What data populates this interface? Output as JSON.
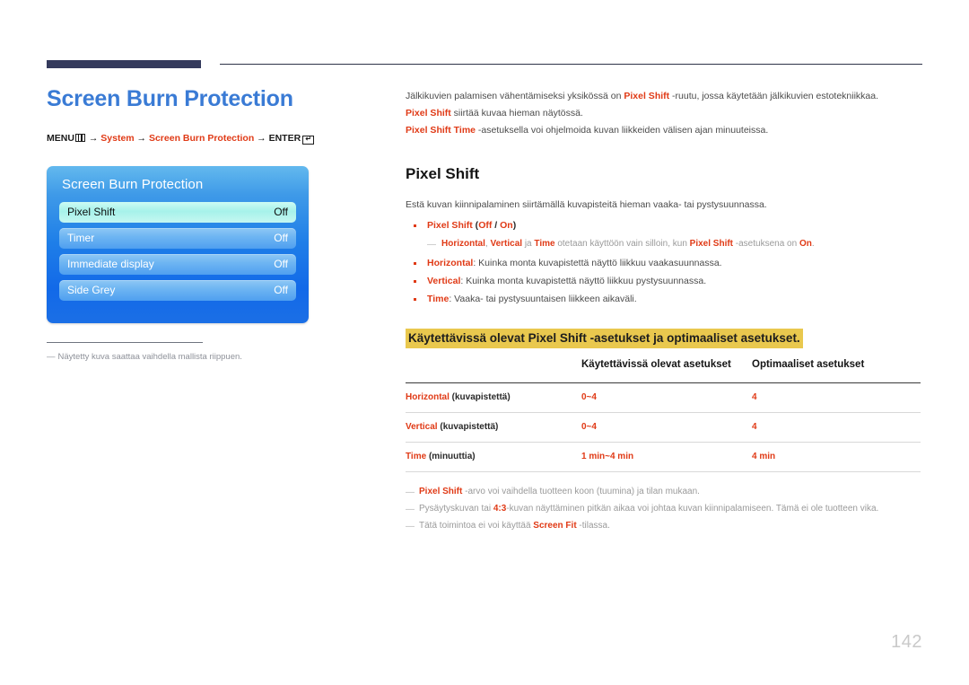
{
  "page": {
    "number": "142"
  },
  "left": {
    "title": "Screen Burn Protection",
    "menu_path": {
      "menu_label": "MENU",
      "menu_icon": "menu-grid-icon",
      "arrow": "→",
      "step1": "System",
      "step2": "Screen Burn Protection",
      "enter_label": "ENTER",
      "enter_icon": "enter-key-icon",
      "enter_glyph": "↵"
    },
    "osd": {
      "title": "Screen Burn Protection",
      "rows": [
        {
          "label": "Pixel Shift",
          "value": "Off",
          "selected": true
        },
        {
          "label": "Timer",
          "value": "Off",
          "selected": false
        },
        {
          "label": "Immediate display",
          "value": "Off",
          "selected": false
        },
        {
          "label": "Side Grey",
          "value": "Off",
          "selected": false
        }
      ]
    },
    "caption": {
      "dash": "―",
      "text": "Näytetty kuva saattaa vaihdella mallista riippuen."
    }
  },
  "right": {
    "intro": [
      {
        "parts": [
          {
            "t": "Jälkikuvien palamisen vähentämiseksi yksikössä on ",
            "s": "plain"
          },
          {
            "t": "Pixel Shift",
            "s": "red"
          },
          {
            "t": " -ruutu, jossa käytetään jälkikuvien estotekniikkaa.",
            "s": "plain"
          }
        ]
      },
      {
        "parts": [
          {
            "t": "Pixel Shift",
            "s": "red"
          },
          {
            "t": " siirtää kuvaa hieman näytössä.",
            "s": "plain"
          }
        ]
      },
      {
        "parts": [
          {
            "t": "Pixel Shift Time",
            "s": "red"
          },
          {
            "t": " -asetuksella voi ohjelmoida kuvan liikkeiden välisen ajan minuuteissa.",
            "s": "plain"
          }
        ]
      }
    ],
    "section_title": "Pixel Shift",
    "lead": "Estä kuvan kiinnipalaminen siirtämällä kuvapisteitä hieman vaaka- tai pystysuunnassa.",
    "bullets": [
      {
        "parts": [
          {
            "t": "Pixel Shift",
            "s": "red"
          },
          {
            "t": " (",
            "s": "dark"
          },
          {
            "t": "Off",
            "s": "red"
          },
          {
            "t": " / ",
            "s": "dark"
          },
          {
            "t": "On",
            "s": "red"
          },
          {
            "t": ")",
            "s": "dark"
          }
        ]
      },
      {
        "parts": [
          {
            "t": "Horizontal",
            "s": "red"
          },
          {
            "t": ": Kuinka monta kuvapistettä näyttö liikkuu vaakasuunnassa.",
            "s": "plain"
          }
        ]
      },
      {
        "parts": [
          {
            "t": "Vertical",
            "s": "red"
          },
          {
            "t": ": Kuinka monta kuvapistettä näyttö liikkuu pystysuunnassa.",
            "s": "plain"
          }
        ]
      },
      {
        "parts": [
          {
            "t": "Time",
            "s": "red"
          },
          {
            "t": ": Vaaka- tai pystysuuntaisen liikkeen aikaväli.",
            "s": "plain"
          }
        ]
      }
    ],
    "subnote": {
      "dash": "―",
      "parts": [
        {
          "t": "Horizontal",
          "s": "red"
        },
        {
          "t": ", ",
          "s": "plain"
        },
        {
          "t": "Vertical",
          "s": "red"
        },
        {
          "t": " ja ",
          "s": "plain"
        },
        {
          "t": "Time",
          "s": "red"
        },
        {
          "t": " otetaan käyttöön vain silloin, kun ",
          "s": "plain"
        },
        {
          "t": "Pixel Shift",
          "s": "red"
        },
        {
          "t": " -asetuksena on ",
          "s": "plain"
        },
        {
          "t": "On",
          "s": "red"
        },
        {
          "t": ".",
          "s": "plain"
        }
      ]
    },
    "highlight_heading": "Käytettävissä olevat Pixel Shift -asetukset ja optimaaliset asetukset.",
    "table": {
      "headers": [
        "",
        "Käytettävissä olevat asetukset",
        "Optimaaliset asetukset"
      ],
      "rows": [
        {
          "label_red": "Horizontal",
          "label_rest": " (kuvapistettä)",
          "available": "0~4",
          "optimal": "4"
        },
        {
          "label_red": "Vertical",
          "label_rest": " (kuvapistettä)",
          "available": "0~4",
          "optimal": "4"
        },
        {
          "label_red": "Time",
          "label_rest": " (minuuttia)",
          "available": "1 min~4 min",
          "optimal": "4 min"
        }
      ]
    },
    "footnotes": [
      {
        "dash": "―",
        "parts": [
          {
            "t": "Pixel Shift",
            "s": "red"
          },
          {
            "t": " -arvo voi vaihdella tuotteen koon (tuumina) ja tilan mukaan.",
            "s": "plain"
          }
        ]
      },
      {
        "dash": "―",
        "parts": [
          {
            "t": "Pysäytyskuvan tai ",
            "s": "plain"
          },
          {
            "t": "4:3",
            "s": "red"
          },
          {
            "t": "-kuvan näyttäminen pitkän aikaa voi johtaa kuvan kiinnipalamiseen. Tämä ei ole tuotteen vika.",
            "s": "plain"
          }
        ]
      },
      {
        "dash": "―",
        "parts": [
          {
            "t": "Tätä toimintoa ei voi käyttää ",
            "s": "plain"
          },
          {
            "t": "Screen Fit",
            "s": "red"
          },
          {
            "t": " -tilassa.",
            "s": "plain"
          }
        ]
      }
    ]
  },
  "colors": {
    "accent_blue": "#3a7bd5",
    "accent_red": "#e03a16",
    "highlight_yellow": "#e9c84e",
    "rule_navy": "#343a5c",
    "osd_blue": "#1f7fe8",
    "osd_selected": "#a6f2ea"
  }
}
